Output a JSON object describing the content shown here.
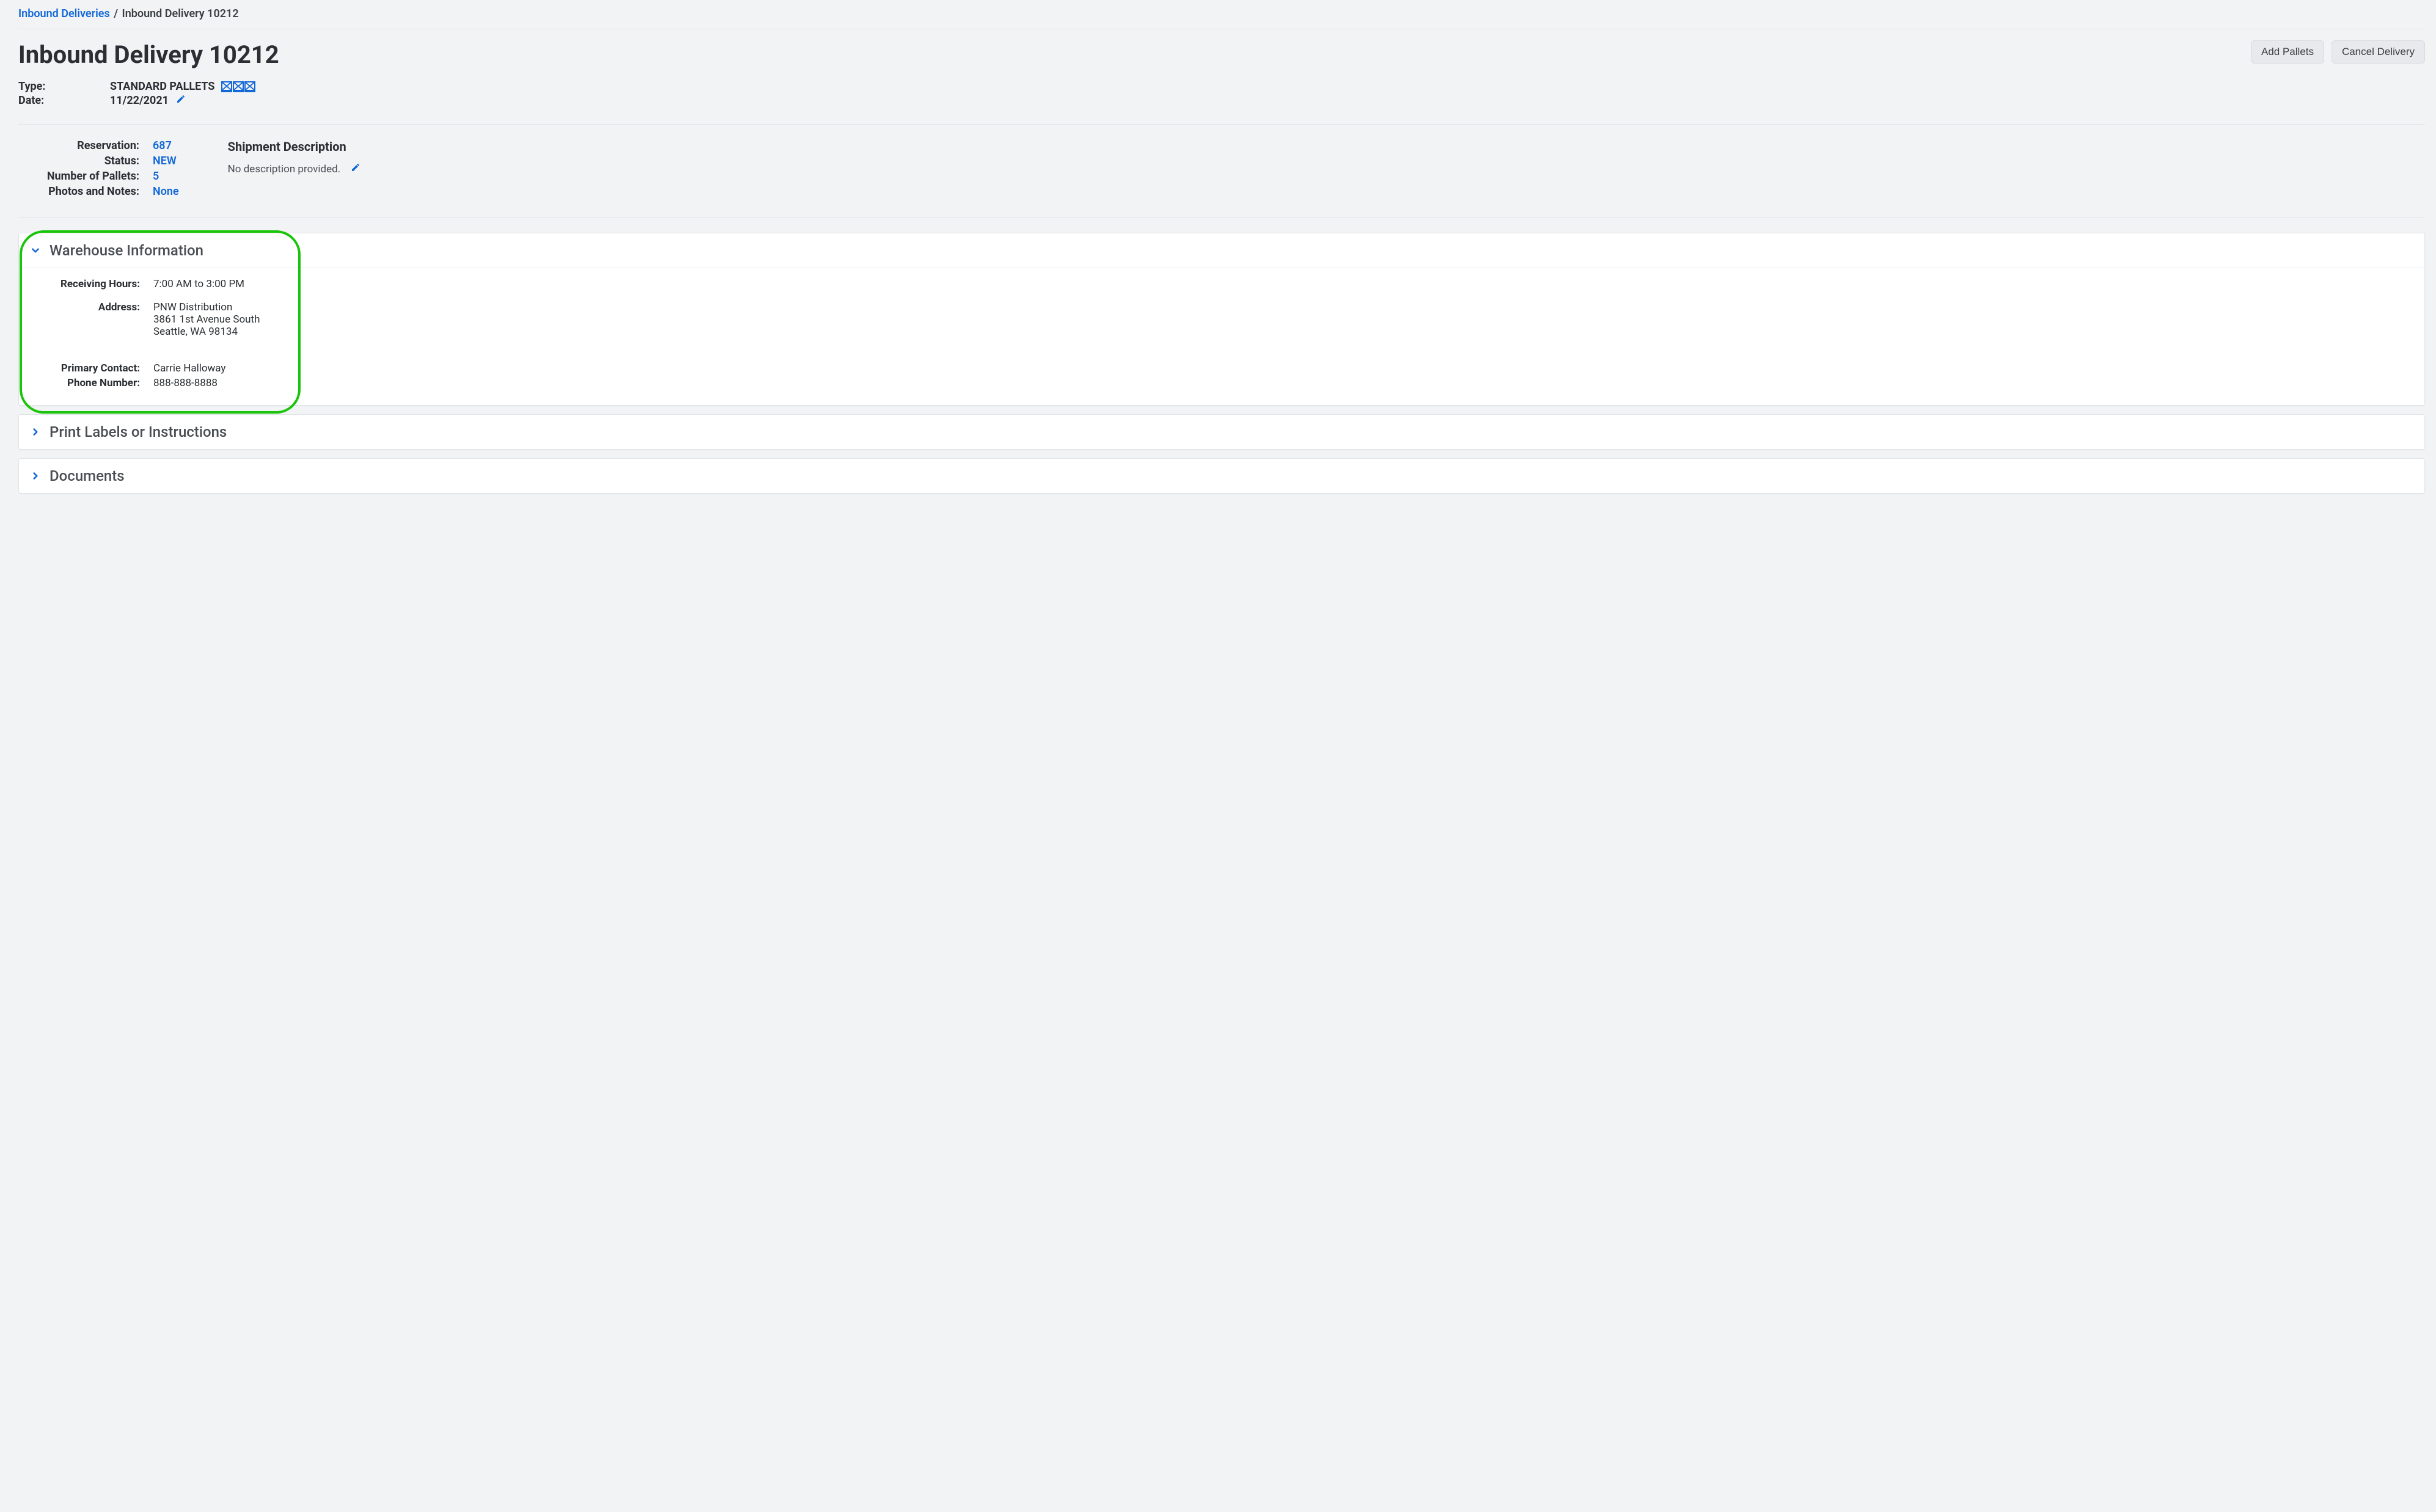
{
  "breadcrumb": {
    "root": "Inbound Deliveries",
    "current": "Inbound Delivery 10212"
  },
  "page": {
    "title": "Inbound Delivery 10212",
    "add_pallets_label": "Add Pallets",
    "cancel_delivery_label": "Cancel Delivery"
  },
  "meta": {
    "type_label": "Type:",
    "type_value": "STANDARD PALLETS",
    "date_label": "Date:",
    "date_value": "11/22/2021"
  },
  "summary": {
    "reservation_label": "Reservation:",
    "reservation_value": "687",
    "status_label": "Status:",
    "status_value": "NEW",
    "pallets_label": "Number of Pallets:",
    "pallets_value": "5",
    "notes_label": "Photos and Notes:",
    "notes_value": "None"
  },
  "shipment": {
    "title": "Shipment Description",
    "text": "No description provided."
  },
  "warehouse": {
    "title": "Warehouse Information",
    "hours_label": "Receiving Hours:",
    "hours_value": "7:00 AM to 3:00 PM",
    "address_label": "Address:",
    "address_line1": "PNW Distribution",
    "address_line2": "3861 1st Avenue South",
    "address_line3": "Seattle, WA 98134",
    "contact_label": "Primary Contact:",
    "contact_value": "Carrie Halloway",
    "phone_label": "Phone Number:",
    "phone_value": "888-888-8888"
  },
  "labels_panel": {
    "title": "Print Labels or Instructions"
  },
  "documents_panel": {
    "title": "Documents"
  }
}
